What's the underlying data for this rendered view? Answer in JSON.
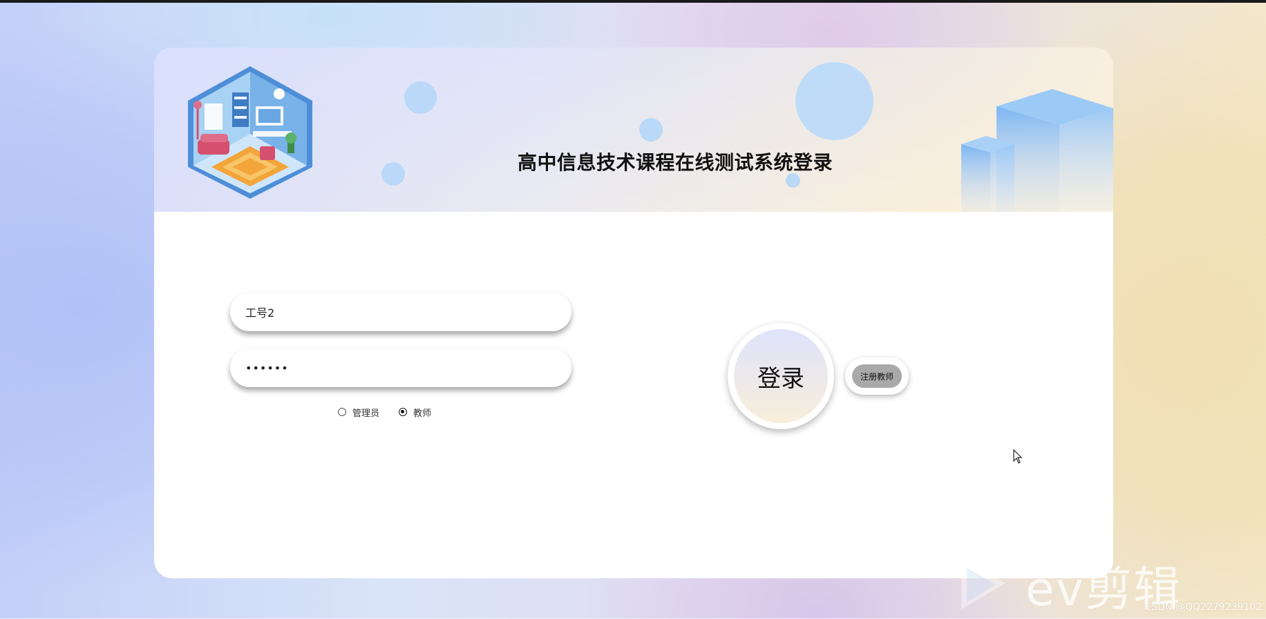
{
  "header": {
    "title": "高中信息技术课程在线测试系统登录",
    "logo_icon": "isometric-room-illustration",
    "decor_icon": "blue-cubes-decoration"
  },
  "form": {
    "username_value": "工号2",
    "password_value": "••••••",
    "roles": [
      {
        "label": "管理员",
        "selected": false
      },
      {
        "label": "教师",
        "selected": true
      }
    ]
  },
  "buttons": {
    "login_label": "登录",
    "register_label": "注册教师"
  },
  "overlay": {
    "watermark_text": "ev剪辑",
    "credit_text": "CSDN @QQ2279239102"
  },
  "colors": {
    "header_gradient_start": "#dfe3fb",
    "header_gradient_end": "#fbf3e3",
    "bubble": "#b7d7f8",
    "register_button": "#a9a9a9"
  }
}
